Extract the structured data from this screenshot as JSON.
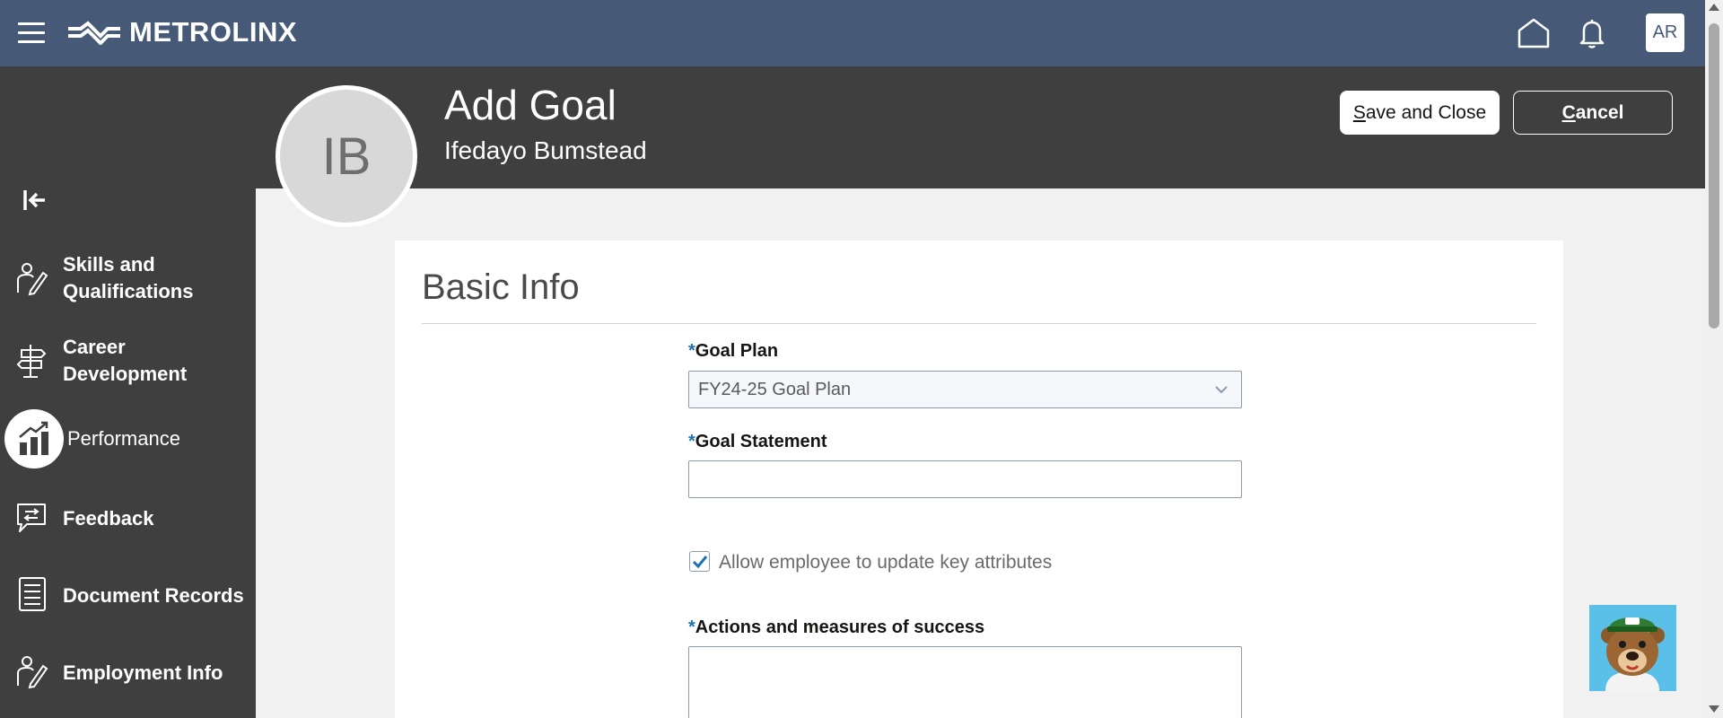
{
  "header": {
    "logo_text": "METROLINX",
    "user_initials": "AR"
  },
  "sidebar": {
    "items": [
      {
        "label_line1": "Skills and",
        "label_line2": "Qualifications",
        "icon": "skills-icon"
      },
      {
        "label_line1": "Career",
        "label_line2": "Development",
        "icon": "signpost-icon"
      },
      {
        "label_line1": "Performance",
        "label_line2": "",
        "icon": "bar-chart-icon",
        "active": true
      },
      {
        "label_line1": "Feedback",
        "label_line2": "",
        "icon": "feedback-icon"
      },
      {
        "label_line1": "Document Records",
        "label_line2": "",
        "icon": "document-icon"
      },
      {
        "label_line1": "Employment Info",
        "label_line2": "",
        "icon": "employment-icon"
      }
    ]
  },
  "page": {
    "title": "Add Goal",
    "subtitle": "Ifedayo Bumstead",
    "person_initials": "IB",
    "save_label_accel": "S",
    "save_label_rest": "ave and Close",
    "cancel_label_accel": "C",
    "cancel_label_rest": "ancel"
  },
  "form": {
    "section_title": "Basic Info",
    "goal_plan_label": "Goal Plan",
    "goal_plan_value": "FY24-25 Goal Plan",
    "goal_statement_label": "Goal Statement",
    "goal_statement_value": "",
    "allow_update_label": "Allow employee to update key attributes",
    "allow_update_checked": true,
    "actions_label": "Actions and measures of success",
    "required_marker": "*"
  },
  "colors": {
    "topbar": "#465a78",
    "sidebar": "#3f3f3f",
    "accent": "#1a73b8"
  }
}
